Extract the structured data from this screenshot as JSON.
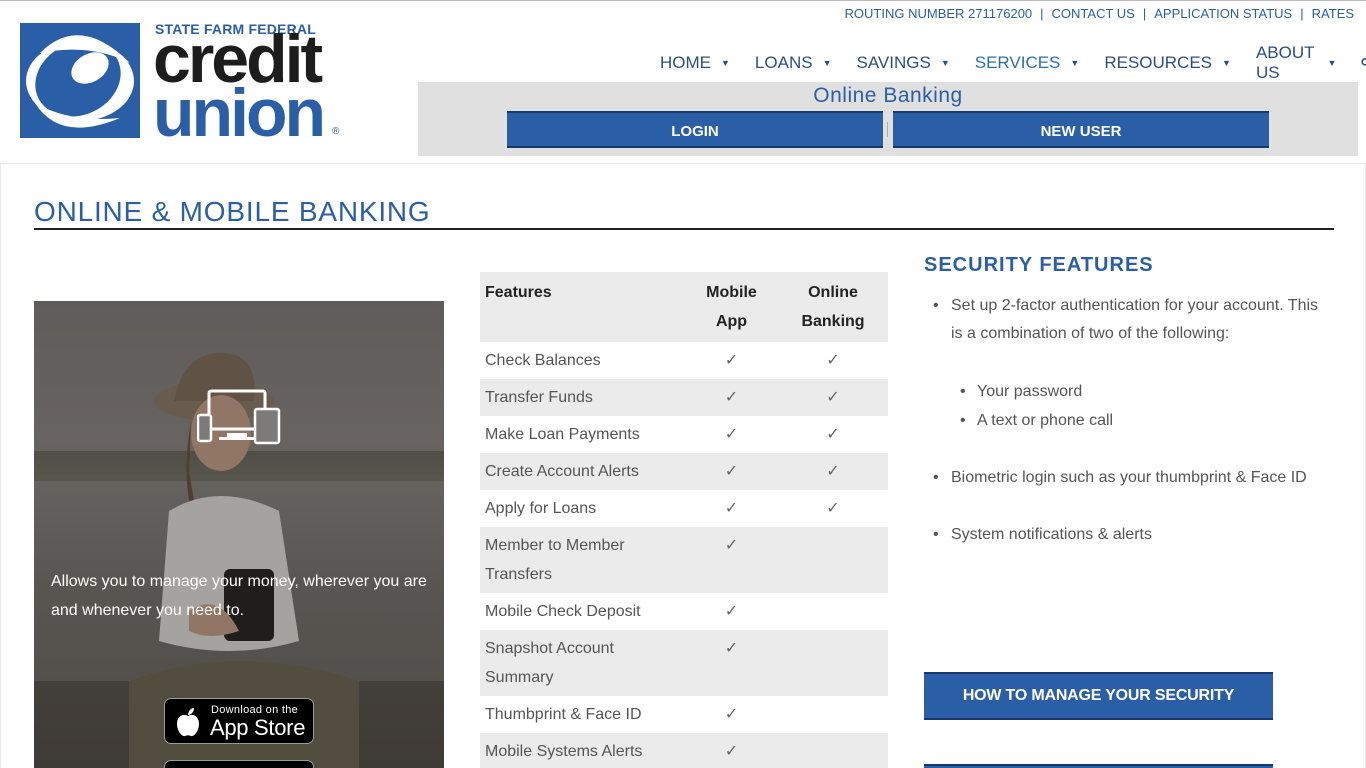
{
  "brand": {
    "name_small": "STATE FARM FEDERAL",
    "name_credit": "credit",
    "name_union": "union",
    "registered": "®",
    "primary_color": "#2a5fa8",
    "dark_color": "#1d1d1d"
  },
  "utility_nav": {
    "routing": "ROUTING NUMBER 271176200",
    "contact": "CONTACT US",
    "application_status": "APPLICATION STATUS",
    "rates": "RATES",
    "separator": "|"
  },
  "main_nav": {
    "items": [
      {
        "label": "HOME"
      },
      {
        "label": "LOANS"
      },
      {
        "label": "SAVINGS"
      },
      {
        "label": "SERVICES"
      },
      {
        "label": "RESOURCES"
      },
      {
        "label": "ABOUT US"
      }
    ],
    "caret": "▼",
    "search_icon": "search-icon"
  },
  "online_banking": {
    "title": "Online Banking",
    "login": "LOGIN",
    "new_user": "NEW USER"
  },
  "page": {
    "title": "ONLINE & MOBILE BANKING"
  },
  "hero": {
    "text": "Allows you to manage your money, wherever you are and whenever you need to.",
    "appstore_small": "Download on the",
    "appstore_big": "App Store",
    "devices_icon": "devices-icon",
    "apple_icon": "apple-icon"
  },
  "features_table": {
    "headers": [
      "Features",
      "Mobile App",
      "Online Banking"
    ],
    "check": "✓",
    "rows": [
      {
        "feature": "Check Balances",
        "mobile": "✓",
        "online": "✓"
      },
      {
        "feature": "Transfer Funds",
        "mobile": "✓",
        "online": "✓"
      },
      {
        "feature": "Make Loan Payments",
        "mobile": "✓",
        "online": "✓"
      },
      {
        "feature": "Create Account Alerts",
        "mobile": "✓",
        "online": "✓"
      },
      {
        "feature": "Apply for Loans",
        "mobile": "✓",
        "online": "✓"
      },
      {
        "feature": "Member to Member Transfers",
        "mobile": "✓",
        "online": ""
      },
      {
        "feature": "Mobile Check Deposit",
        "mobile": "✓",
        "online": ""
      },
      {
        "feature": "Snapshot Account Summary",
        "mobile": "✓",
        "online": ""
      },
      {
        "feature": "Thumbprint & Face ID",
        "mobile": "✓",
        "online": ""
      },
      {
        "feature": "Mobile Systems Alerts",
        "mobile": "✓",
        "online": ""
      }
    ]
  },
  "security": {
    "title": "SECURITY FEATURES",
    "item1": "Set up 2-factor authentication for your account. This is a combination of two of the following:",
    "sub1": "Your password",
    "sub2": "A text or phone call",
    "item2": "Biometric login such as your thumbprint & Face ID",
    "item3": "System notifications & alerts",
    "button": "HOW TO MANAGE YOUR SECURITY"
  }
}
